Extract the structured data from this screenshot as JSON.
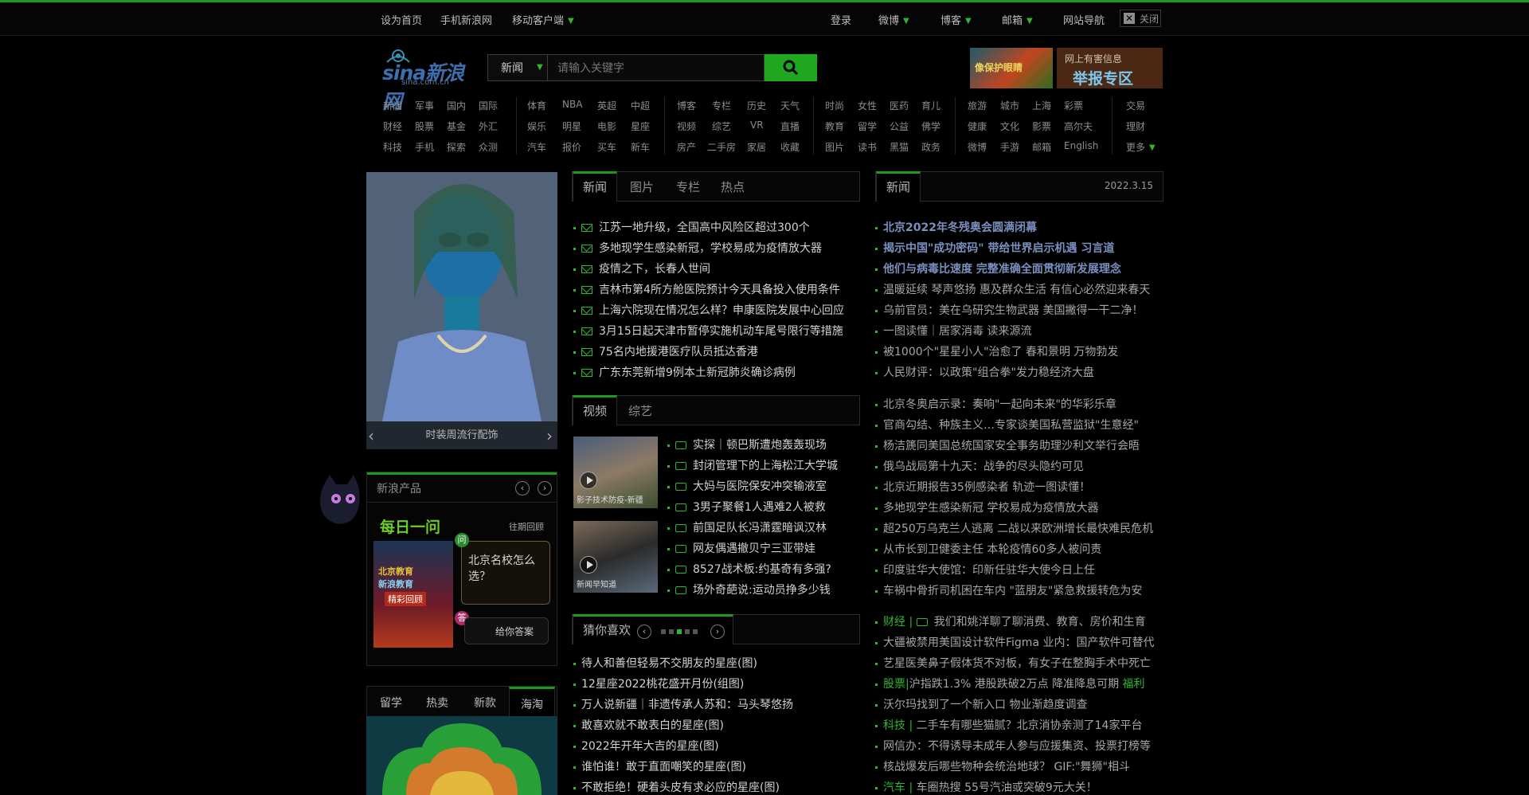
{
  "topbar": {
    "left": [
      {
        "label": "设为首页"
      },
      {
        "label": "手机新浪网"
      },
      {
        "label": "移动客户端",
        "dropdown": true
      }
    ],
    "right": [
      {
        "label": "登录"
      },
      {
        "label": "微博",
        "dropdown": true
      },
      {
        "label": "博客",
        "dropdown": true
      },
      {
        "label": "邮箱",
        "dropdown": true
      },
      {
        "label": "网站导航"
      }
    ],
    "close_label": "关闭"
  },
  "logo": {
    "text": "sina新浪网",
    "domain": "sina.com.cn"
  },
  "search": {
    "category": "新闻",
    "placeholder": "请输入关键字"
  },
  "ads": {
    "ad1": "像保护眼睛",
    "ad2_line1": "网上有害信息",
    "ad2_line2": "举报专区"
  },
  "nav": {
    "col1": [
      [
        "新闻",
        "军事",
        "国内",
        "国际"
      ],
      [
        "财经",
        "股票",
        "基金",
        "外汇"
      ],
      [
        "科技",
        "手机",
        "探索",
        "众测"
      ]
    ],
    "col2": [
      [
        "体育",
        "NBA",
        "英超",
        "中超"
      ],
      [
        "娱乐",
        "明星",
        "电影",
        "星座"
      ],
      [
        "汽车",
        "报价",
        "买车",
        "新车"
      ]
    ],
    "col3": [
      [
        "博客",
        "专栏",
        "历史",
        "天气"
      ],
      [
        "视频",
        "综艺",
        "VR",
        "直播"
      ],
      [
        "房产",
        "二手房",
        "家居",
        "收藏"
      ]
    ],
    "col4": [
      [
        "时尚",
        "女性",
        "医药",
        "育儿"
      ],
      [
        "教育",
        "留学",
        "公益",
        "佛学"
      ],
      [
        "图片",
        "读书",
        "黑猫",
        "政务"
      ]
    ],
    "col5": [
      [
        "旅游",
        "城市",
        "上海",
        "彩票"
      ],
      [
        "健康",
        "文化",
        "影票",
        "高尔夫"
      ],
      [
        "微博",
        "手游",
        "邮箱",
        "English"
      ]
    ],
    "col6": [
      "交易",
      "理财",
      "更多"
    ]
  },
  "slideshow": {
    "caption": "时装周流行配饰"
  },
  "product_box": {
    "title": "新浪产品",
    "daily": "每日一问",
    "past": "往期回顾",
    "img_line1": "北京教育",
    "img_line2": "新浪教育",
    "img_line3": "精彩回顾",
    "question_mark": "问",
    "question": "北京名校怎么选？",
    "answer_mark": "答",
    "answer": "给你答案"
  },
  "shop_tabs": [
    "留学",
    "热卖",
    "新款",
    "海淘"
  ],
  "news_tabs": [
    "新闻",
    "图片",
    "专栏",
    "热点"
  ],
  "news_list": [
    "江苏一地升级，全国高中风险区超过300个",
    "多地现学生感染新冠，学校易成为疫情放大器",
    "疫情之下，长春人世间",
    "吉林市第4所方舱医院预计今天具备投入使用条件",
    "上海六院现在情况怎么样？申康医院发展中心回应",
    "3月15日起天津市暂停实施机动车尾号限行等措施",
    "75名内地援港医疗队员抵达香港",
    "广东东莞新增9例本土新冠肺炎确诊病例"
  ],
  "right_head": {
    "tab": "新闻",
    "date": "2022.3.15"
  },
  "right_top": [
    {
      "text": "北京2022年冬残奥会圆满闭幕",
      "style": "blue"
    },
    {
      "text": "揭示中国\"成功密码\" 带给世界启示机遇 习言道",
      "style": "blue"
    },
    {
      "text": "他们与病毒比速度 完整准确全面贯彻新发展理念",
      "style": "blue"
    },
    {
      "text": "温暖延续 琴声悠扬 惠及群众生活 有信心必然迎来春天",
      "style": "grey"
    },
    {
      "text": "乌前官员：美在乌研究生物武器 美国撇得一干二净！",
      "style": "grey"
    },
    {
      "text": "一图读懂｜居家消毒 读来源流",
      "style": "grey"
    },
    {
      "text": "被1000个\"星星小人\"治愈了 春和景明 万物勃发",
      "style": "grey"
    },
    {
      "text": "人民财评：以政策\"组合拳\"发力稳经济大盘",
      "style": "grey"
    }
  ],
  "right_mid": [
    "北京冬奥启示录：奏响\"一起向未来\"的华彩乐章",
    "官商勾结、种族主义…专家谈美国私营监狱\"生意经\"",
    "杨洁篪同美国总统国家安全事务助理沙利文举行会晤",
    "俄乌战局第十九天：战争的尽头隐约可见",
    "北京近期报告35例感染者 轨迹一图读懂！",
    "多地现学生感染新冠 学校易成为疫情放大器",
    "超250万乌克兰人逃离 二战以来欧洲增长最快难民危机",
    "从市长到卫健委主任 本轮疫情60多人被问责",
    "印度驻华大使馆：印新任驻华大使今日上任",
    "车祸中骨折司机困在车内 \"蓝朋友\"紧急救援转危为安"
  ],
  "right_bot": [
    {
      "tag": "财经",
      "text": "我们和姚洋聊了聊消费、教育、房价和生育",
      "vid": true
    },
    {
      "tag": "",
      "text": "大疆被禁用美国设计软件Figma 业内：国产软件可替代",
      "vid": false
    },
    {
      "tag": "",
      "text": "艺星医美鼻子假体货不对板，有女子在整胸手术中死亡",
      "vid": false
    },
    {
      "tag": "股票",
      "text": "沪指跌1.3% 港股跌破2万点 降准降息可期",
      "extra": "福利",
      "vid": false
    },
    {
      "tag": "",
      "text": "沃尔玛找到了一个新入口 物业渐趋度调查",
      "vid": false
    },
    {
      "tag": "科技",
      "text": "二手车有哪些猫腻？北京消协亲测了14家平台",
      "vid": false
    },
    {
      "tag": "",
      "text": "网信办：不得诱导未成年人参与应援集资、投票打榜等",
      "vid": false
    },
    {
      "tag": "",
      "text": "核战爆发后哪些物种会统治地球？ GIF:\"舞狮\"相斗",
      "vid": false
    },
    {
      "tag": "汽车",
      "text": "车圈热搜 55号汽油或突破9元大关！",
      "vid": false
    }
  ],
  "video_tabs": [
    "视频",
    "综艺"
  ],
  "video_thumbs": [
    "影子技术防疫-新疆",
    "新闻早知道"
  ],
  "video_list": [
    "实探｜顿巴斯遭炮轰轰现场",
    "封闭管理下的上海松江大学城",
    "大妈与医院保安冲突输液室",
    "3男子聚餐1人遇难2人被救",
    "前国足队长冯潇霆暗讽汉林",
    "网友偶遇撤贝宁三亚带娃",
    "8527战术板:约基奇有多强?",
    "场外奇葩说:运动员挣多少钱"
  ],
  "guess": {
    "title": "猜你喜欢"
  },
  "guess_list": [
    "待人和善但轻易不交朋友的星座(图)",
    "12星座2022桃花盛开月份(组图)",
    "万人说新疆｜非遗传承人苏和：马头琴悠扬",
    "敢喜欢就不敢表白的星座(图)",
    "2022年开年大吉的星座(图)",
    "谁怕谁！敢于直面嘲笑的星座(图)",
    "不敢拒绝！硬着头皮有求必应的星座(图)"
  ]
}
